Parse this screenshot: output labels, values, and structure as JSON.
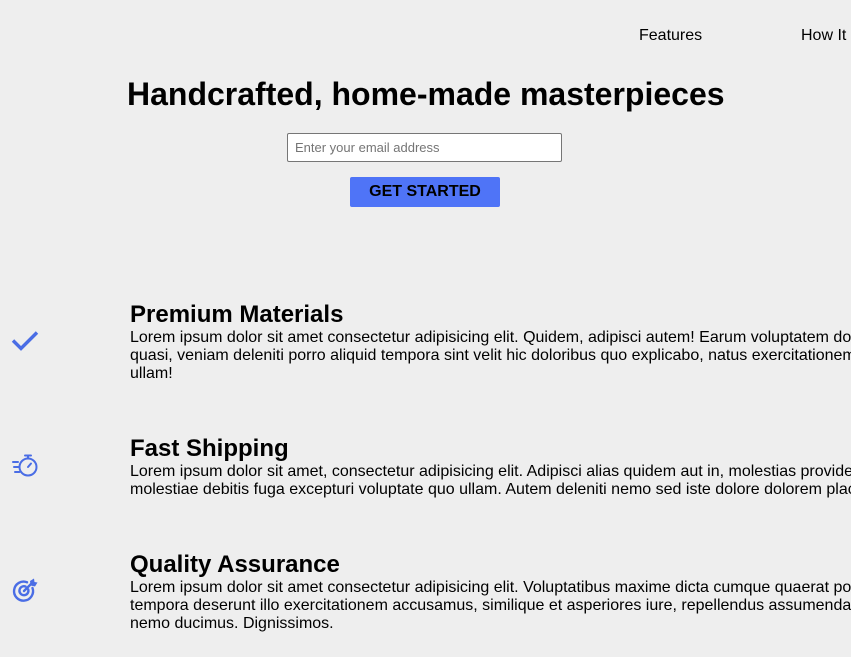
{
  "nav": {
    "features": "Features",
    "how_it_works": "How It"
  },
  "hero": {
    "title": "Handcrafted, home-made masterpieces",
    "email_placeholder": "Enter your email address",
    "cta_label": "GET STARTED"
  },
  "features": [
    {
      "icon": "checkmark-icon",
      "title": "Premium Materials",
      "text": "Lorem ipsum dolor sit amet consectetur adipisicing elit. Quidem, adipisci autem! Earum voluptatem do quasi, veniam deleniti porro aliquid tempora sint velit hic doloribus quo explicabo, natus exercitationem ullam!"
    },
    {
      "icon": "stopwatch-icon",
      "title": "Fast Shipping",
      "text": "Lorem ipsum dolor sit amet, consectetur adipisicing elit. Adipisci alias quidem aut in, molestias provide molestiae debitis fuga excepturi voluptate quo ullam. Autem deleniti nemo sed iste dolore dolorem plac"
    },
    {
      "icon": "target-icon",
      "title": "Quality Assurance",
      "text": "Lorem ipsum dolor sit amet consectetur adipisicing elit. Voluptatibus maxime dicta cumque quaerat po tempora deserunt illo exercitationem accusamus, similique et asperiores iure, repellendus assumenda nemo ducimus. Dignissimos."
    }
  ],
  "colors": {
    "background": "#eeeeee",
    "accent": "#4f74f7",
    "icon": "#4a6de5"
  }
}
